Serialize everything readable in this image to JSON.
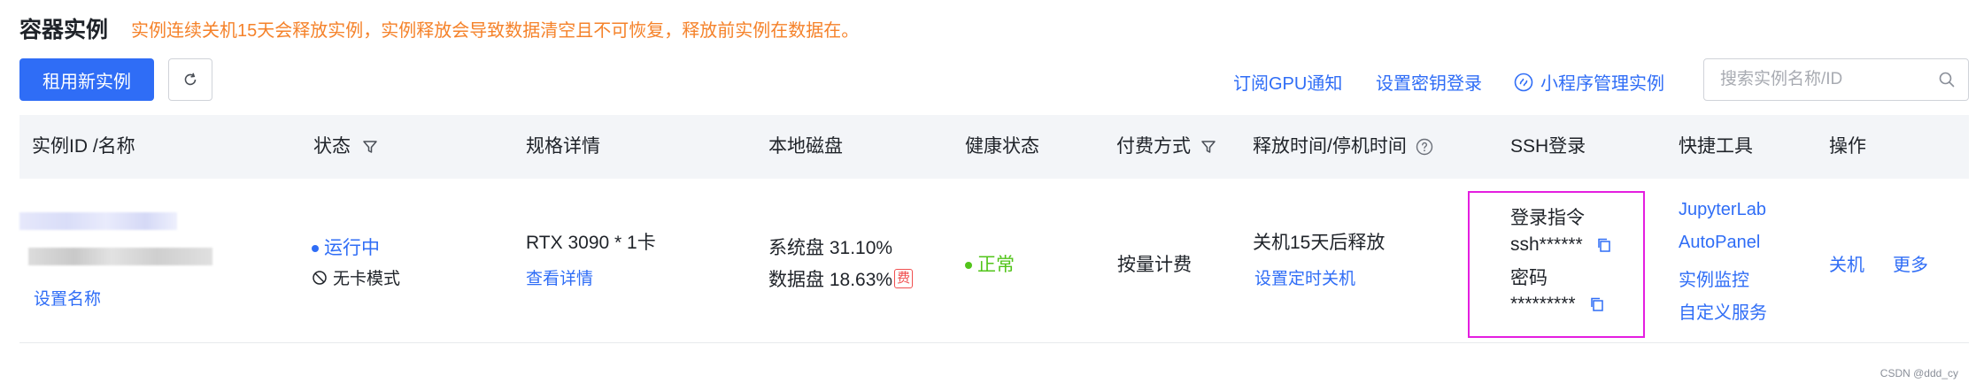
{
  "page": {
    "title": "容器实例",
    "notice": "实例连续关机15天会释放实例，实例释放会导致数据清空且不可恢复，释放前实例在数据在。"
  },
  "toolbar": {
    "rent_button": "租用新实例",
    "gpu_notify": "订阅GPU通知",
    "key_login": "设置密钥登录",
    "miniapp": "小程序管理实例",
    "search_placeholder": "搜索实例名称/ID"
  },
  "table": {
    "headers": {
      "id": "实例ID /名称",
      "status": "状态",
      "spec": "规格详情",
      "disk": "本地磁盘",
      "health": "健康状态",
      "billing": "付费方式",
      "release": "释放时间/停机时间",
      "ssh": "SSH登录",
      "tools": "快捷工具",
      "ops": "操作"
    },
    "rows": [
      {
        "set_name": "设置名称",
        "status": "运行中",
        "mode": "无卡模式",
        "gpu": "RTX 3090 * 1卡",
        "spec_link": "查看详情",
        "system_disk": "系统盘 31.10%",
        "data_disk": "数据盘 18.63%",
        "fee_badge": "费",
        "health": "正常",
        "billing": "按量计费",
        "release": "关机15天后释放",
        "timer_link": "设置定时关机",
        "ssh_cmd_label": "登录指令",
        "ssh_cmd": "ssh******",
        "password_label": "密码",
        "password": "*********",
        "tools": [
          "JupyterLab",
          "AutoPanel",
          "实例监控",
          "自定义服务"
        ],
        "shutdown": "关机",
        "more": "更多"
      }
    ]
  },
  "watermark": "CSDN @ddd_cy",
  "colors": {
    "primary": "#2f6df6",
    "notice": "#f5822a",
    "success": "#52c41a",
    "highlight_box": "#e41ee0",
    "danger": "#f04f4f"
  }
}
